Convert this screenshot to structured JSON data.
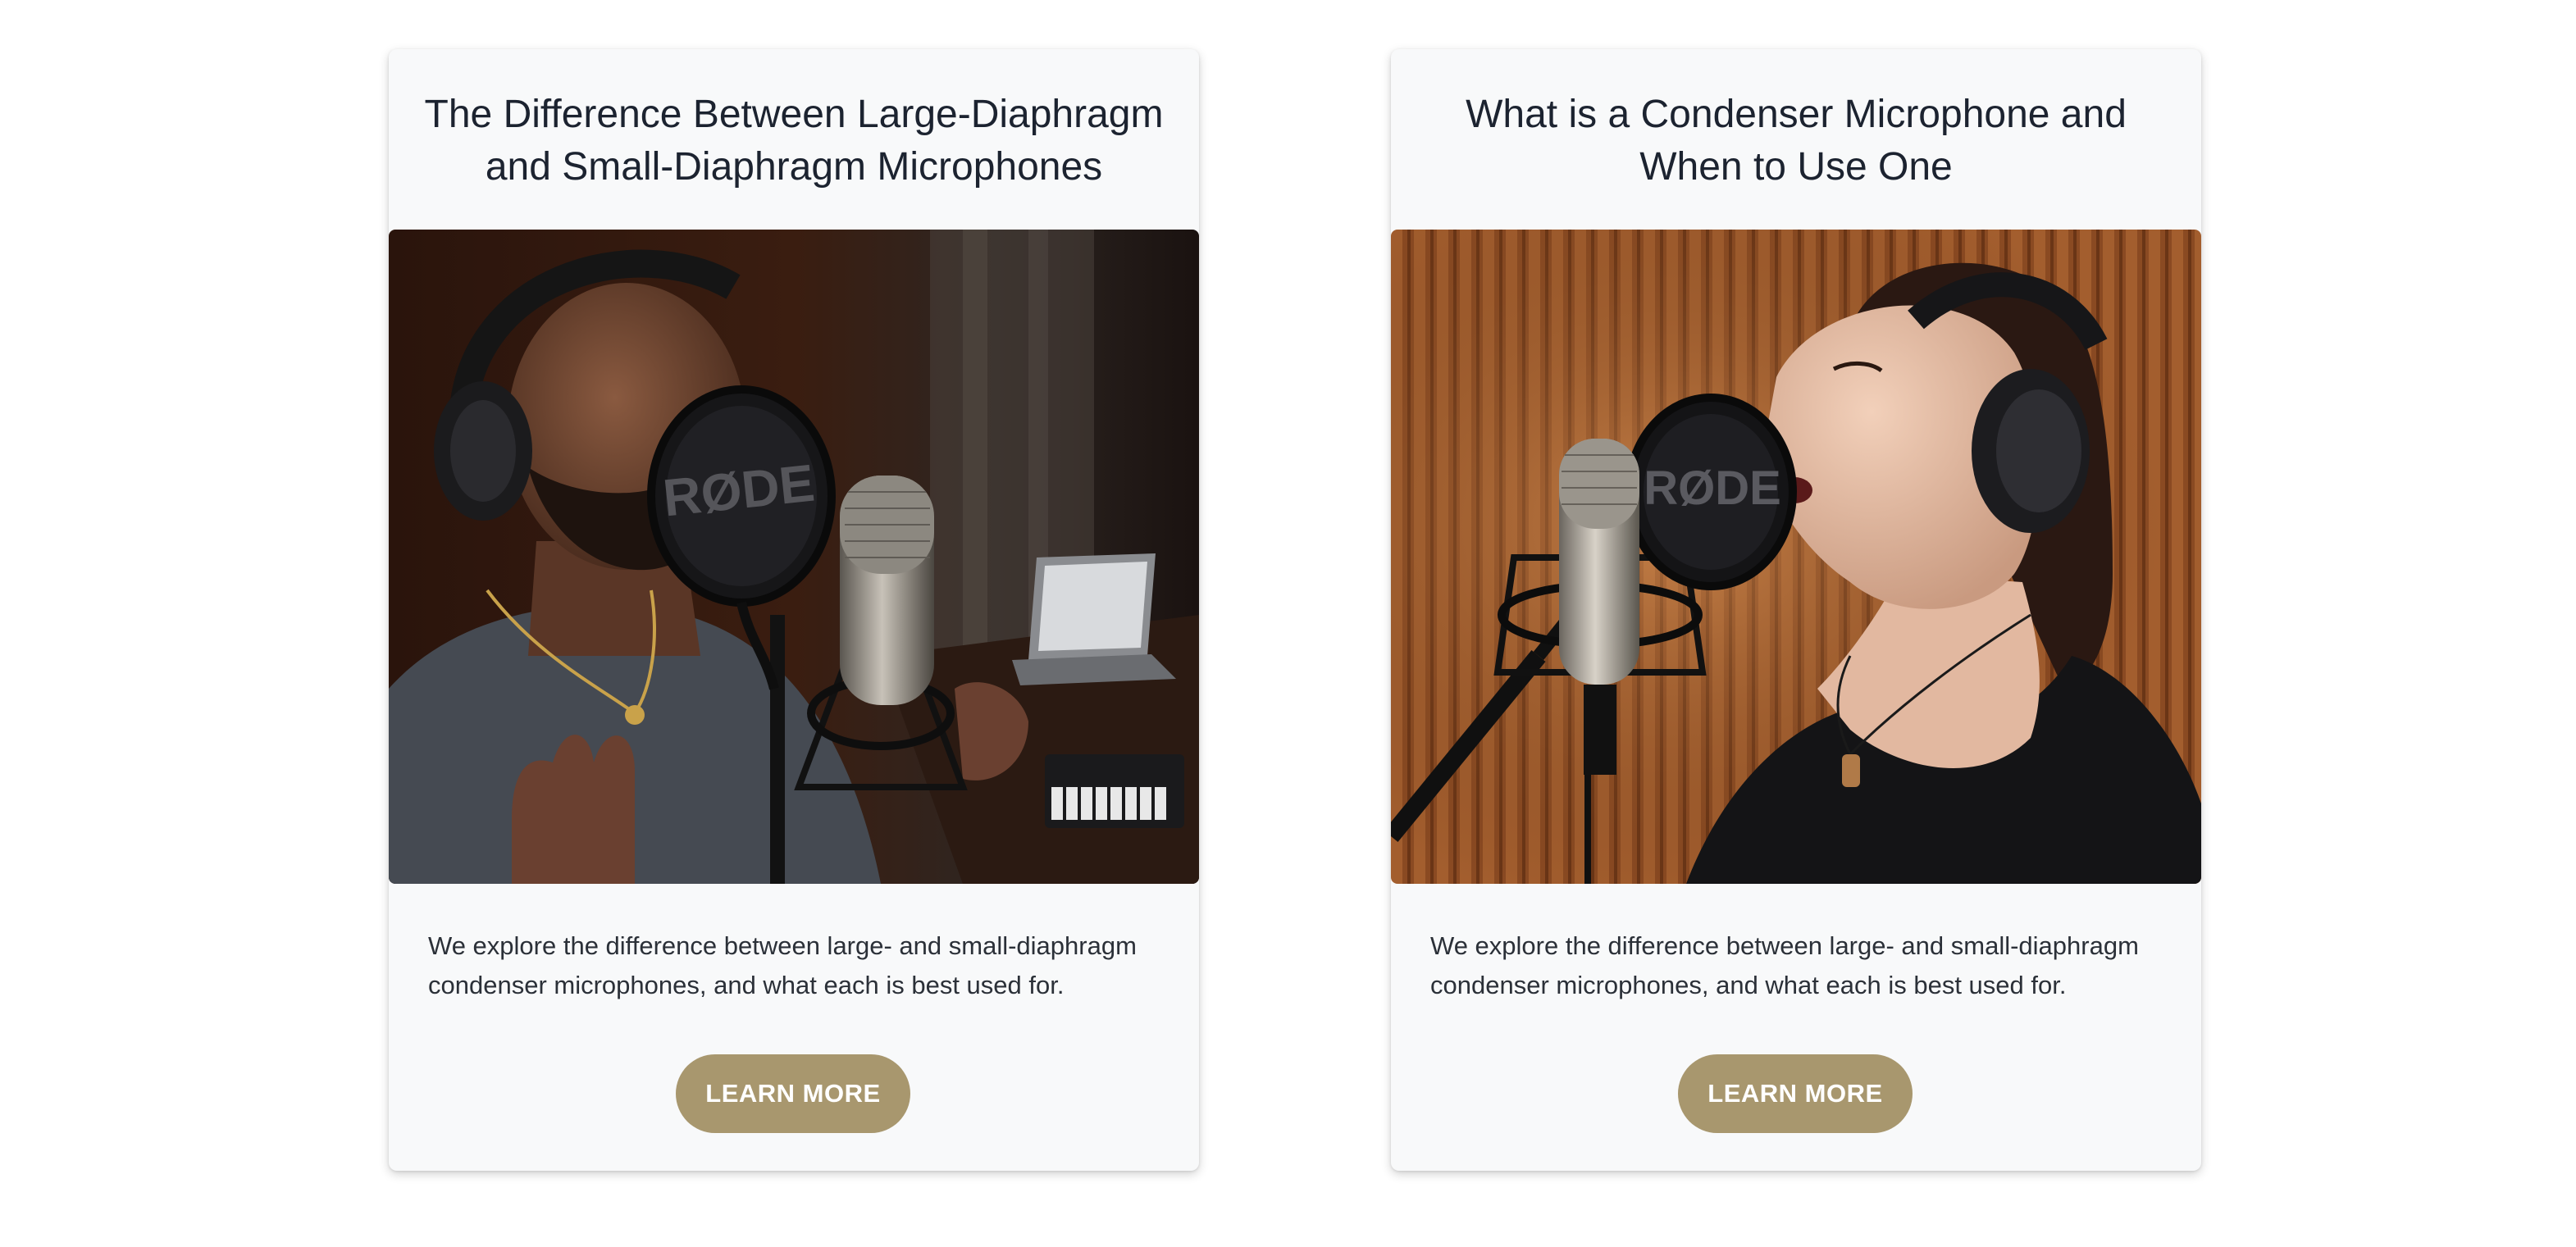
{
  "cards": [
    {
      "title_line1": "The Difference Between Large-Diaphragm",
      "title_line2": "and Small-Diaphragm Microphones",
      "image_logo": "RØDE",
      "description_line1": "We explore the difference between large- and small-diaphragm",
      "description_line2": "condenser microphones, and what each is best used for.",
      "button_label": "LEARN MORE"
    },
    {
      "title_line1": "What is a Condenser Microphone and",
      "title_line2": "When to Use One",
      "image_logo": "RØDE",
      "description_line1": "We explore the difference between large- and small-diaphragm",
      "description_line2": "condenser microphones, and what each is best used for.",
      "button_label": "LEARN MORE"
    }
  ],
  "colors": {
    "card_background": "#f8f9fa",
    "button_background": "#a8976e",
    "button_text": "#ffffff",
    "title_text": "#1c2330"
  }
}
